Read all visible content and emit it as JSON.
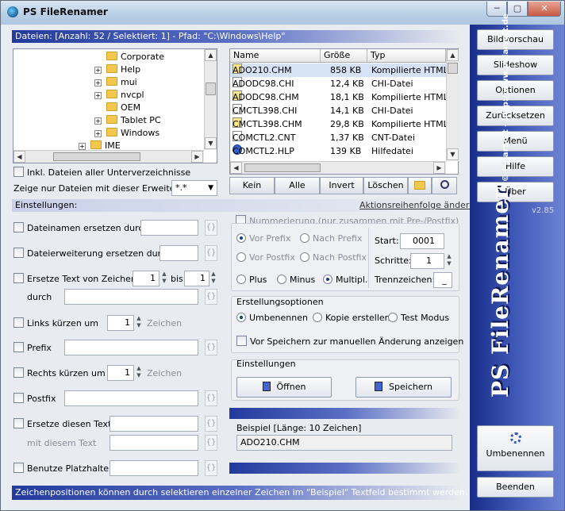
{
  "window": {
    "title": "PS FileRenamer",
    "min": "─",
    "max": "▢",
    "close": "✕"
  },
  "files_header": "Dateien: [Anzahl: 52 / Selektiert: 1]  -  Pfad: \"C:\\Windows\\Help\"",
  "tree": [
    {
      "label": "Corporate",
      "expand": ""
    },
    {
      "label": "Help",
      "expand": "+"
    },
    {
      "label": "mui",
      "expand": "+"
    },
    {
      "label": "nvcpl",
      "expand": "+"
    },
    {
      "label": "OEM",
      "expand": ""
    },
    {
      "label": "Tablet PC",
      "expand": "+"
    },
    {
      "label": "Windows",
      "expand": "+"
    },
    {
      "label": "IME",
      "expand": "+"
    }
  ],
  "file_list": {
    "columns": [
      "Name",
      "Größe",
      "Typ"
    ],
    "rows": [
      {
        "name": "ADO210.CHM",
        "size": "858 KB",
        "type": "Kompilierte HTML-H",
        "icon": "chm"
      },
      {
        "name": "ADODC98.CHI",
        "size": "12,4 KB",
        "type": "CHI-Datei",
        "icon": "file"
      },
      {
        "name": "ADODC98.CHM",
        "size": "18,1 KB",
        "type": "Kompilierte HTML-H",
        "icon": "chm"
      },
      {
        "name": "CMCTL398.CHI",
        "size": "14,1 KB",
        "type": "CHI-Datei",
        "icon": "file"
      },
      {
        "name": "CMCTL398.CHM",
        "size": "29,8 KB",
        "type": "Kompilierte HTML-H",
        "icon": "chm"
      },
      {
        "name": "COMCTL2.CNT",
        "size": "1,37 KB",
        "type": "CNT-Datei",
        "icon": "file"
      },
      {
        "name": "COMCTL2.HLP",
        "size": "139 KB",
        "type": "Hilfedatei",
        "icon": "hlp"
      }
    ]
  },
  "select_buttons": [
    "Kein",
    "Alle",
    "Invert",
    "Löschen"
  ],
  "include_subdirs": "Inkl. Dateien aller Unterverzeichnisse",
  "ext_filter": {
    "label": "Zeige nur Dateien mit dieser Erweiterung:",
    "value": "*.*"
  },
  "settings_bar": "Einstellungen:",
  "action_order_link": "Aktionsreihenfolge ändern",
  "options": {
    "replace_filename": "Dateinamen ersetzen durch",
    "replace_ext": "Dateierweiterung ersetzen durch",
    "replace_text_from": "Ersetze Text von Zeichen",
    "from_value": "1",
    "bis": "bis",
    "to_value": "1",
    "durch": "durch",
    "trim_left": "Links kürzen um",
    "trim_left_value": "1",
    "zeichen": "Zeichen",
    "prefix": "Prefix",
    "trim_right": "Rechts kürzen um",
    "trim_right_value": "1",
    "postfix": "Postfix",
    "replace_this_text": "Ersetze diesen Text",
    "with_this_text": "mit diesem Text",
    "use_placeholder": "Benutze Platzhalter",
    "brace": "{}"
  },
  "numbering": {
    "label": "Nummerierung (nur zusammen mit Pre-/Postfix)",
    "vor_prefix": "Vor Prefix",
    "nach_prefix": "Nach Prefix",
    "vor_postfix": "Vor Postfix",
    "nach_postfix": "Nach Postfix",
    "start_label": "Start:",
    "start_value": "0001",
    "schritte_label": "Schritte:",
    "schritte_value": "1",
    "trenn_label": "Trennzeichen:",
    "trenn_value": "_",
    "plus": "Plus",
    "minus": "Minus",
    "multipl": "Multipl."
  },
  "creation": {
    "title": "Erstellungsoptionen",
    "rename": "Umbenennen",
    "copy": "Kopie erstellen",
    "test": "Test Modus",
    "show_before_save": "Vor Speichern zur manuellen Änderung anzeigen"
  },
  "settings_group": {
    "title": "Einstellungen",
    "open": "Öffnen",
    "save": "Speichern"
  },
  "example": {
    "label": "Beispiel   [Länge: 10 Zeichen]",
    "value": "ADO210.CHM"
  },
  "status_bar": "Zeichenpositionen können durch selektieren einzelner Zeichen im \"Beispiel\" Textfeld bestimmt werden.",
  "sidebar": {
    "buttons": [
      "Bildvorschau",
      "Slideshow",
      "Optionen",
      "Zurücksetzen",
      "Menü",
      "Hilfe",
      "Über"
    ],
    "version": "v2.85",
    "logo": "PS FileRenamer",
    "logo_sub": "© PolarSoft - http://www.polarsoft.de",
    "rename": "Umbenennen",
    "quit": "Beenden"
  },
  "colors": {
    "accent": "#223a9c",
    "sidebar": "#3d56b5"
  }
}
